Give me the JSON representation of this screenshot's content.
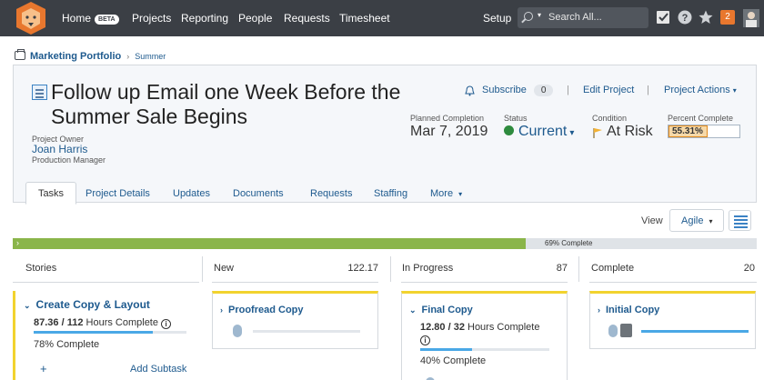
{
  "nav": {
    "items": [
      "Home",
      "Projects",
      "Reporting",
      "People",
      "Requests",
      "Timesheet"
    ],
    "beta": "BETA",
    "setup": "Setup",
    "search_placeholder": "Search All...",
    "notification_count": "2"
  },
  "breadcrumb": {
    "portfolio": "Marketing Portfolio",
    "program": "Summer"
  },
  "project": {
    "title": "Follow up Email one Week Before the Summer Sale Begins",
    "owner_label": "Project Owner",
    "owner_name": "Joan Harris",
    "owner_role": "Production Manager",
    "subscribe_label": "Subscribe",
    "subscribe_count": "0",
    "edit_label": "Edit Project",
    "actions_label": "Project Actions",
    "planned_label": "Planned Completion",
    "planned_value": "Mar 7, 2019",
    "status_label": "Status",
    "status_value": "Current",
    "condition_label": "Condition",
    "condition_value": "At Risk",
    "percent_label": "Percent Complete",
    "percent_value": "55.31%",
    "percent_fraction": 0.5531
  },
  "tabs": [
    "Tasks",
    "Project Details",
    "Updates",
    "Documents",
    "Requests",
    "Staffing",
    "More"
  ],
  "view": {
    "label": "View",
    "mode": "Agile"
  },
  "progress": {
    "text": "69% Complete",
    "fraction": 0.69
  },
  "columns": [
    {
      "name": "Stories",
      "value": ""
    },
    {
      "name": "New",
      "value": "122.17"
    },
    {
      "name": "In Progress",
      "value": "87"
    },
    {
      "name": "Complete",
      "value": "20"
    }
  ],
  "story": {
    "title": "Create Copy & Layout",
    "hours_done": "87.36 / 112",
    "hours_label": " Hours Complete",
    "pct": "78% Complete",
    "fraction": 0.78,
    "add_subtask": "Add Subtask",
    "plus": "+"
  },
  "tasks": [
    {
      "title": "Proofread Copy"
    },
    {
      "title": "Final Copy",
      "hours_done": "12.80 / 32",
      "hours_label": " Hours Complete",
      "pct": "40% Complete",
      "fraction": 0.4
    },
    {
      "title": "Initial Copy"
    }
  ],
  "colors": {
    "nav_bg": "#3b3f45",
    "link": "#1e5a8e",
    "progress": "#8ab54a",
    "accent_orange": "#e8772e",
    "card_accent": "#f2d32e"
  }
}
